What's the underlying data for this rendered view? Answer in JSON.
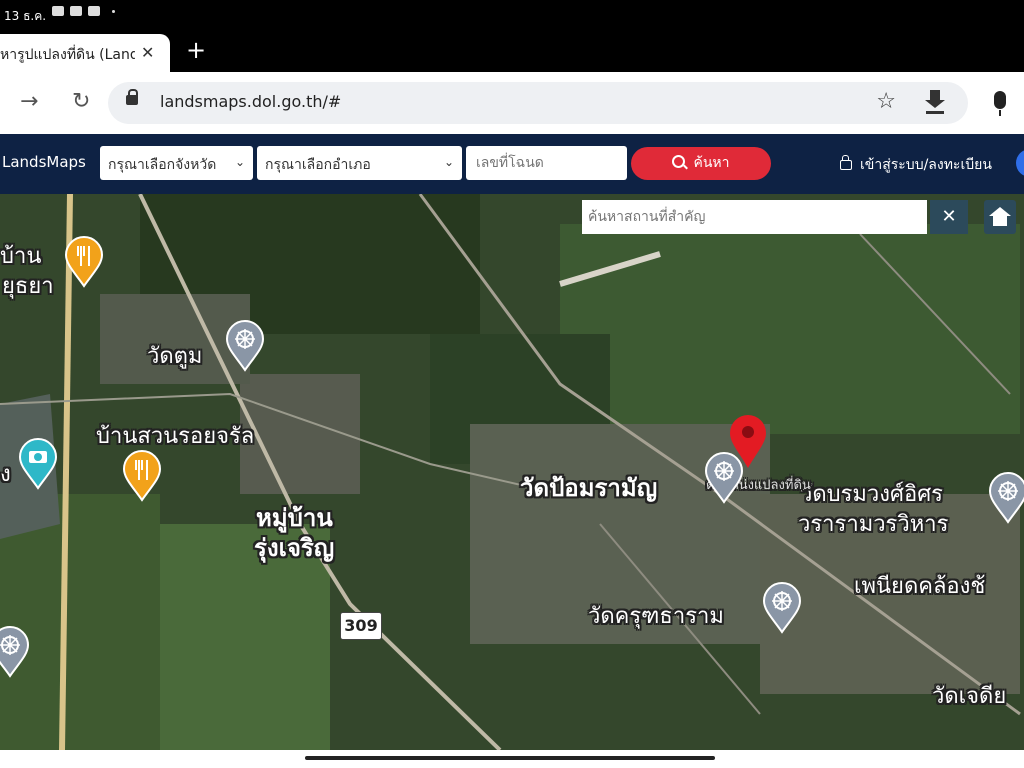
{
  "status": {
    "time": "13 ธ.ค."
  },
  "browser": {
    "tab_title": "หารูปแปลงที่ดิน (Lands",
    "url": "landsmaps.dol.go.th/#"
  },
  "site": {
    "brand": "LandsMaps",
    "province_select": "กรุณาเลือกจังหวัด",
    "district_select": "กรุณาเลือกอำเภอ",
    "deed_placeholder": "เลขที่โฉนด",
    "search_label": "ค้นหา",
    "login_label": "เข้าสู่ระบบ/ลงทะเบียน"
  },
  "map": {
    "place_search_placeholder": "ค้นหาสถานที่สำคัญ",
    "route_number": "309",
    "labels": [
      "วัดตูม",
      "บ้านสวนรอยจรัล",
      "หมู่บ้าน",
      "รุ่งเจริญ",
      "วัดป้อมรามัญ",
      "วัดบรมวงศ์อิศร",
      "วรารามวรวิหาร",
      "เพนียดคล้องช้",
      "วัดครุฑธาราม",
      "วัดเจดีย",
      "บ้าน",
      "ยุธยา",
      "ง"
    ],
    "marker_label": "ตำแหน่งแปลงที่ดิน"
  },
  "colors": {
    "header": "#0e2244",
    "search_button": "#e02a38",
    "map_button": "#2c4a5b",
    "marker": "#e31b23"
  }
}
